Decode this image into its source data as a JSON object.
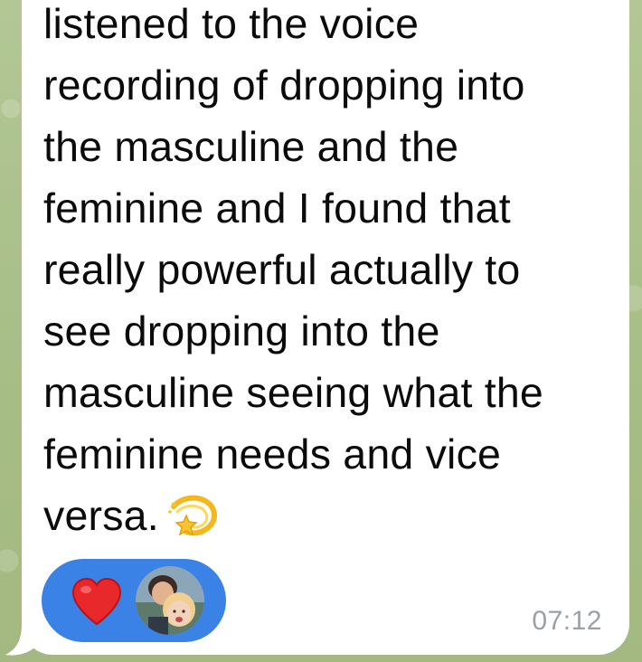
{
  "message": {
    "lines": [
      "listened to the voice",
      "recording of dropping into",
      "the masculine and the",
      "feminine and I found that",
      "really powerful actually to",
      "see dropping into the",
      "masculine seeing what the",
      "feminine needs and vice",
      "versa."
    ],
    "emoji": "dizzy-star-emoji",
    "time": "07:12"
  },
  "reaction": {
    "emoji": "red-heart-icon",
    "reactor": "user-avatar"
  },
  "colors": {
    "bubble": "#ffffff",
    "reaction_pill": "#3b82e6",
    "timestamp": "#9aa0a6",
    "wallpaper": "#a9bf8a"
  }
}
